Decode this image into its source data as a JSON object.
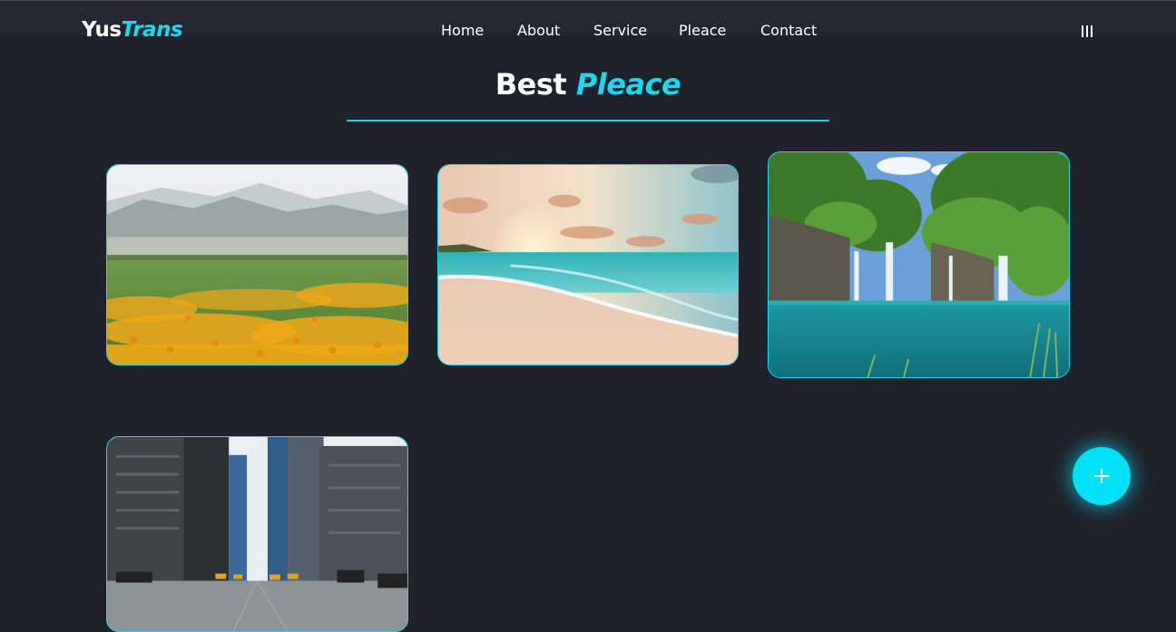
{
  "brand": {
    "part1": "Yus",
    "part2": "Trans"
  },
  "nav": {
    "home": "Home",
    "about": "About",
    "service": "Service",
    "pleace": "Pleace",
    "contact": "Contact"
  },
  "section": {
    "title_main": "Best",
    "title_accent": "Pleace"
  },
  "places": [
    {
      "icon": "mountain-meadow-photo"
    },
    {
      "icon": "beach-sunset-photo"
    },
    {
      "icon": "waterfall-lagoon-photo"
    },
    {
      "icon": "city-street-photo"
    }
  ],
  "colors": {
    "accent": "#19d8ef",
    "background": "#1f222b",
    "fab": "#00e0f6"
  }
}
